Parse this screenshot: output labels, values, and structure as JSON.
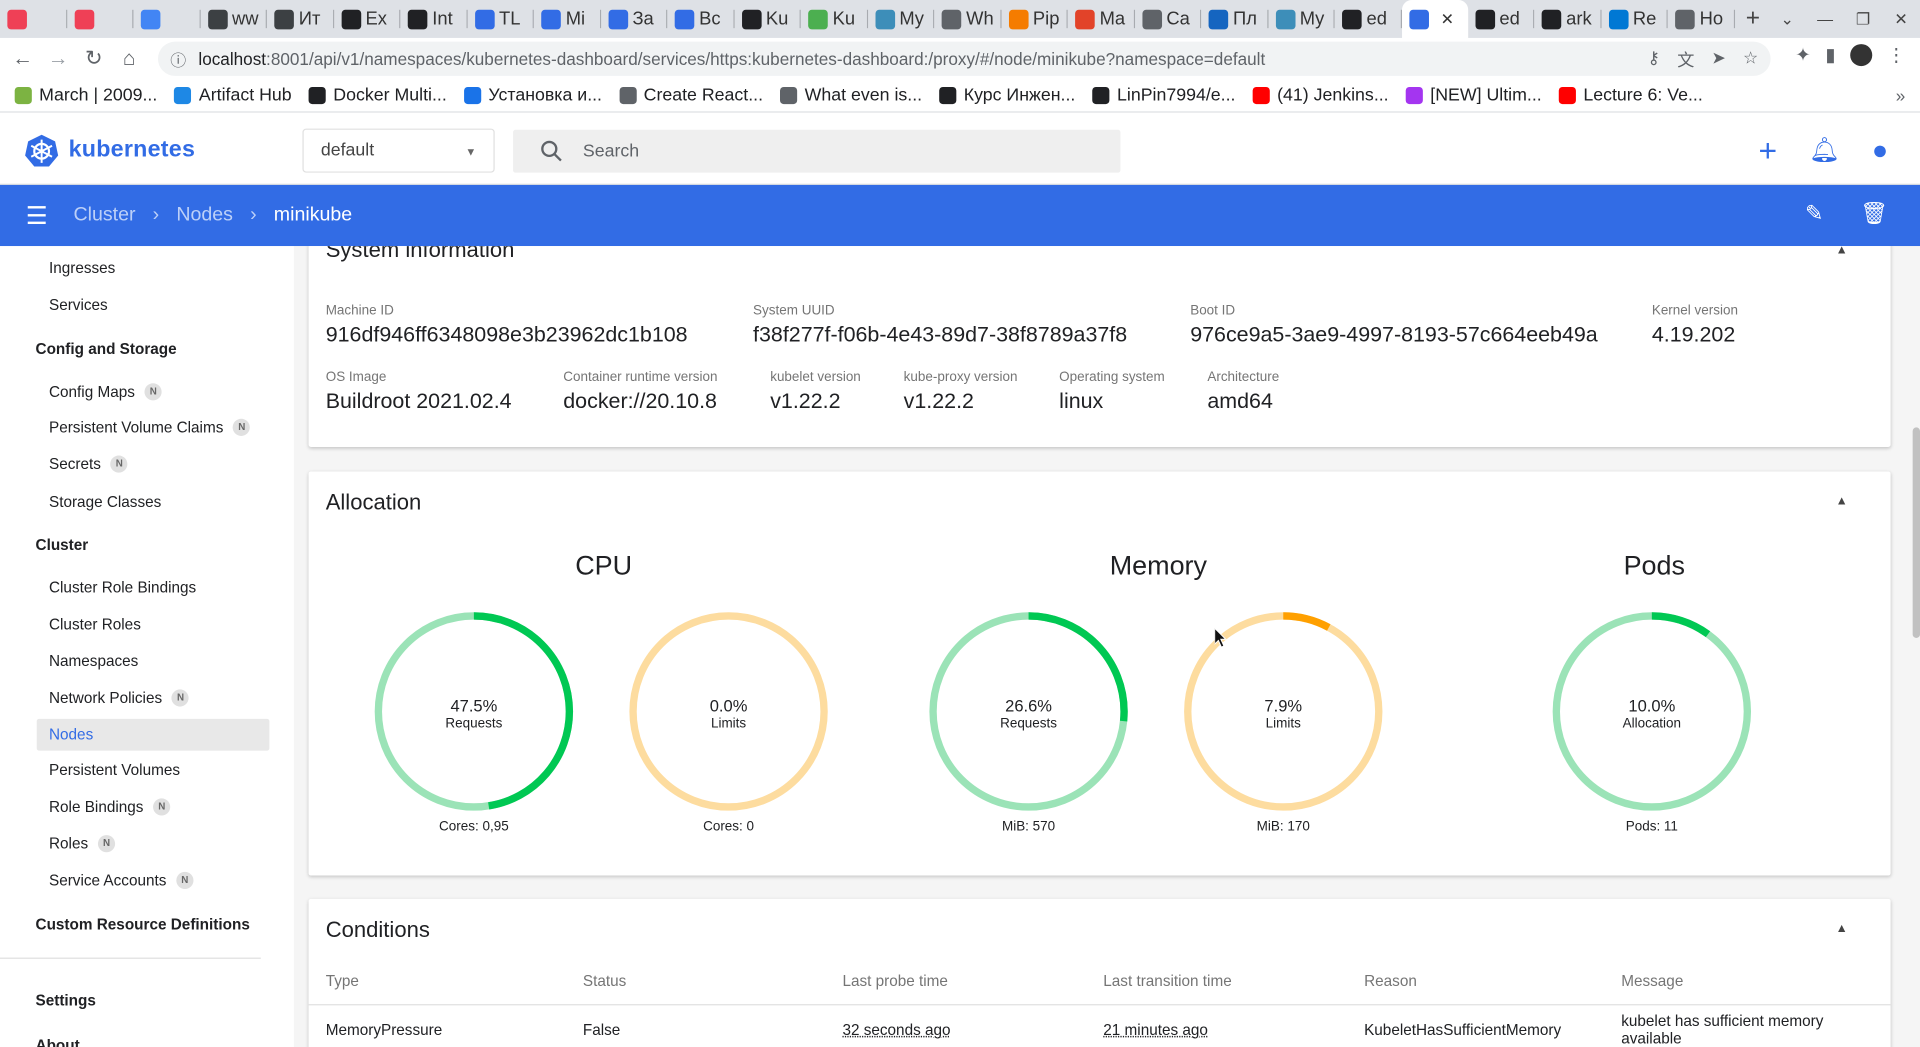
{
  "browser": {
    "tabs": [
      {
        "label": "",
        "icon": "pocket-icon",
        "color": "#ef4056"
      },
      {
        "label": "",
        "icon": "pocket-icon",
        "color": "#ef4056"
      },
      {
        "label": "",
        "icon": "translate-icon",
        "color": "#4285f4"
      },
      {
        "label": "ww",
        "icon": "user-icon",
        "color": "#3c4043"
      },
      {
        "label": "Ит",
        "icon": "user-icon",
        "color": "#3c4043"
      },
      {
        "label": "Ex",
        "icon": "openai-icon",
        "color": "#202124"
      },
      {
        "label": "Int",
        "icon": "openai-icon",
        "color": "#202124"
      },
      {
        "label": "TL",
        "icon": "kubernetes-icon",
        "color": "#326ce5"
      },
      {
        "label": "Mi",
        "icon": "kubernetes-icon",
        "color": "#326ce5"
      },
      {
        "label": "За",
        "icon": "kubernetes-icon",
        "color": "#326ce5"
      },
      {
        "label": "Вс",
        "icon": "kubernetes-icon",
        "color": "#326ce5"
      },
      {
        "label": "Ku",
        "icon": "cross-circle-icon",
        "color": "#202124"
      },
      {
        "label": "Ku",
        "icon": "hexagon-icon",
        "color": "#4caf50"
      },
      {
        "label": "My",
        "icon": "book-icon",
        "color": "#3d8eb9"
      },
      {
        "label": "Wh",
        "icon": "globe-icon",
        "color": "#5f6368"
      },
      {
        "label": "Pip",
        "icon": "box-icon",
        "color": "#f57c00"
      },
      {
        "label": "Ma",
        "icon": "gitlab-icon",
        "color": "#e24329"
      },
      {
        "label": "Ca",
        "icon": "dots-icon",
        "color": "#5f6368"
      },
      {
        "label": "Пл",
        "icon": "flag-icon",
        "color": "#1565c0"
      },
      {
        "label": "My",
        "icon": "book-icon",
        "color": "#3d8eb9"
      },
      {
        "label": "ed",
        "icon": "github-icon",
        "color": "#202124"
      },
      {
        "label": "",
        "icon": "kubernetes-icon",
        "color": "#326ce5",
        "active": true
      },
      {
        "label": "ed",
        "icon": "github-icon",
        "color": "#202124"
      },
      {
        "label": "ark",
        "icon": "github-icon",
        "color": "#202124"
      },
      {
        "label": "Re",
        "icon": "cloud-icon",
        "color": "#0078d4"
      },
      {
        "label": "Ho",
        "icon": "globe-icon",
        "color": "#5f6368"
      }
    ],
    "url_host": "localhost",
    "url_rest": ":8001/api/v1/namespaces/kubernetes-dashboard/services/https:kubernetes-dashboard:/proxy/#/node/minikube?namespace=default",
    "bookmarks": [
      {
        "label": "March | 2009...",
        "icon": "grid-icon",
        "color": "#7cb342"
      },
      {
        "label": "Artifact Hub",
        "icon": "hexagon-icon",
        "color": "#1e88e5"
      },
      {
        "label": "Docker Multi...",
        "icon": "docker-icon",
        "color": "#202124"
      },
      {
        "label": "Установка и...",
        "icon": "circle-icon",
        "color": "#1a73e8"
      },
      {
        "label": "Create React...",
        "icon": "globe-icon",
        "color": "#5f6368"
      },
      {
        "label": "What even is...",
        "icon": "globe-icon",
        "color": "#5f6368"
      },
      {
        "label": "Курс Инжен...",
        "icon": "square-icon",
        "color": "#202124"
      },
      {
        "label": "LinPin7994/e...",
        "icon": "github-icon",
        "color": "#202124"
      },
      {
        "label": "(41) Jenkins...",
        "icon": "youtube-icon",
        "color": "#ff0000"
      },
      {
        "label": "[NEW] Ultim...",
        "icon": "udemy-icon",
        "color": "#a435f0"
      },
      {
        "label": "Lecture 6: Ve...",
        "icon": "youtube-icon",
        "color": "#ff0000"
      }
    ],
    "bookmarks_more": "»"
  },
  "app": {
    "name": "kubernetes",
    "namespace": "default",
    "search_placeholder": "Search",
    "brand_color": "#326ce5"
  },
  "breadcrumb": {
    "items": [
      "Cluster",
      "Nodes",
      "minikube"
    ]
  },
  "sidebar": {
    "items": [
      {
        "label": "Ingresses",
        "type": "item",
        "badge": ""
      },
      {
        "label": "Services",
        "type": "item",
        "badge": ""
      },
      {
        "label": "Config and Storage",
        "type": "section",
        "badge": ""
      },
      {
        "label": "Config Maps",
        "type": "item",
        "badge": "N"
      },
      {
        "label": "Persistent Volume Claims",
        "type": "item",
        "badge": "N"
      },
      {
        "label": "Secrets",
        "type": "item",
        "badge": "N"
      },
      {
        "label": "Storage Classes",
        "type": "item",
        "badge": ""
      },
      {
        "label": "Cluster",
        "type": "section",
        "badge": ""
      },
      {
        "label": "Cluster Role Bindings",
        "type": "item",
        "badge": ""
      },
      {
        "label": "Cluster Roles",
        "type": "item",
        "badge": ""
      },
      {
        "label": "Namespaces",
        "type": "item",
        "badge": ""
      },
      {
        "label": "Network Policies",
        "type": "item",
        "badge": "N"
      },
      {
        "label": "Nodes",
        "type": "item",
        "badge": "",
        "active": true
      },
      {
        "label": "Persistent Volumes",
        "type": "item",
        "badge": ""
      },
      {
        "label": "Role Bindings",
        "type": "item",
        "badge": "N"
      },
      {
        "label": "Roles",
        "type": "item",
        "badge": "N"
      },
      {
        "label": "Service Accounts",
        "type": "item",
        "badge": "N"
      },
      {
        "label": "Custom Resource Definitions",
        "type": "section",
        "badge": ""
      },
      {
        "label": "Settings",
        "type": "section",
        "badge": ""
      },
      {
        "label": "About",
        "type": "section",
        "badge": ""
      }
    ]
  },
  "system_info": {
    "title": "System information",
    "row1": [
      {
        "label": "Machine ID",
        "value": "916df946ff6348098e3b23962dc1b108"
      },
      {
        "label": "System UUID",
        "value": "f38f277f-f06b-4e43-89d7-38f8789a37f8"
      },
      {
        "label": "Boot ID",
        "value": "976ce9a5-3ae9-4997-8193-57c664eeb49a"
      },
      {
        "label": "Kernel version",
        "value": "4.19.202"
      }
    ],
    "row2": [
      {
        "label": "OS Image",
        "value": "Buildroot 2021.02.4"
      },
      {
        "label": "Container runtime version",
        "value": "docker://20.10.8"
      },
      {
        "label": "kubelet version",
        "value": "v1.22.2"
      },
      {
        "label": "kube-proxy version",
        "value": "v1.22.2"
      },
      {
        "label": "Operating system",
        "value": "linux"
      },
      {
        "label": "Architecture",
        "value": "amd64"
      }
    ]
  },
  "allocation": {
    "title": "Allocation",
    "groups": [
      {
        "title": "CPU"
      },
      {
        "title": "Memory"
      },
      {
        "title": "Pods"
      }
    ],
    "gauges": [
      {
        "percent": "47.5%",
        "fraction": 0.475,
        "label": "Requests",
        "footer": "Cores: 0,95",
        "track": "#9be3b7",
        "fill": "#00c853"
      },
      {
        "percent": "0.0%",
        "fraction": 0.0,
        "label": "Limits",
        "footer": "Cores: 0",
        "track": "#fddc9f",
        "fill": "#ffa000"
      },
      {
        "percent": "26.6%",
        "fraction": 0.266,
        "label": "Requests",
        "footer": "MiB: 570",
        "track": "#9be3b7",
        "fill": "#00c853"
      },
      {
        "percent": "7.9%",
        "fraction": 0.079,
        "label": "Limits",
        "footer": "MiB: 170",
        "track": "#fddc9f",
        "fill": "#ffa000"
      },
      {
        "percent": "10.0%",
        "fraction": 0.1,
        "label": "Allocation",
        "footer": "Pods: 11",
        "track": "#9be3b7",
        "fill": "#00c853"
      }
    ]
  },
  "conditions": {
    "title": "Conditions",
    "headers": [
      "Type",
      "Status",
      "Last probe time",
      "Last transition time",
      "Reason",
      "Message"
    ],
    "rows": [
      [
        "MemoryPressure",
        "False",
        "32 seconds ago",
        "21 minutes ago",
        "KubeletHasSufficientMemory",
        "kubelet has sufficient memory available"
      ]
    ]
  }
}
